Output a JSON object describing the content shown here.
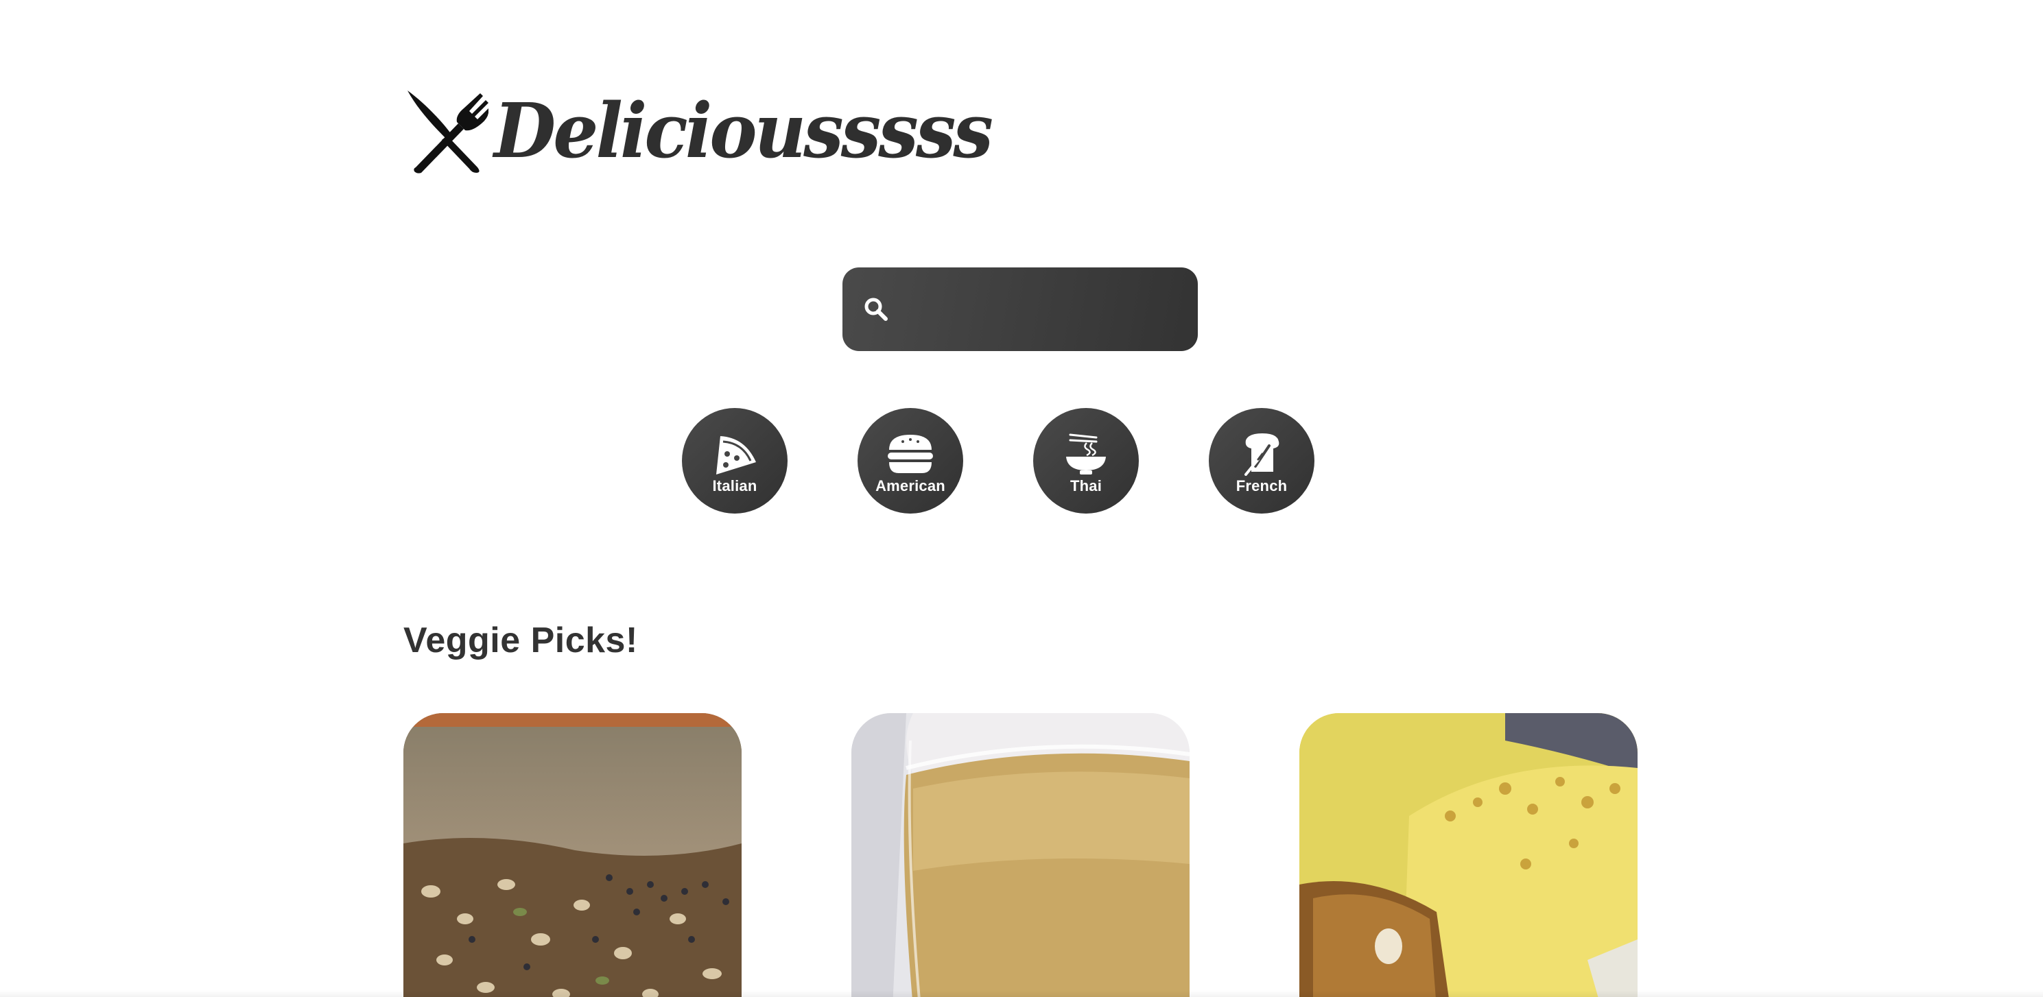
{
  "brand": {
    "name": "Deliciousssss",
    "logo_icon": "crossed-knife-fork-icon"
  },
  "search": {
    "icon": "search-icon",
    "value": "",
    "placeholder": ""
  },
  "cuisines": [
    {
      "label": "Italian",
      "icon": "pizza-slice-icon"
    },
    {
      "label": "American",
      "icon": "hamburger-icon"
    },
    {
      "label": "Thai",
      "icon": "noodle-bowl-icon"
    },
    {
      "label": "French",
      "icon": "bread-toast-icon"
    }
  ],
  "veggie": {
    "title": "Veggie Picks!",
    "cards": [
      {
        "image": "seeded-bread-photo"
      },
      {
        "image": "yellow-smoothie-photo"
      },
      {
        "image": "lemon-cake-photo"
      }
    ]
  },
  "colors": {
    "dark": "#333333",
    "text": "#333333",
    "background": "#ffffff"
  }
}
